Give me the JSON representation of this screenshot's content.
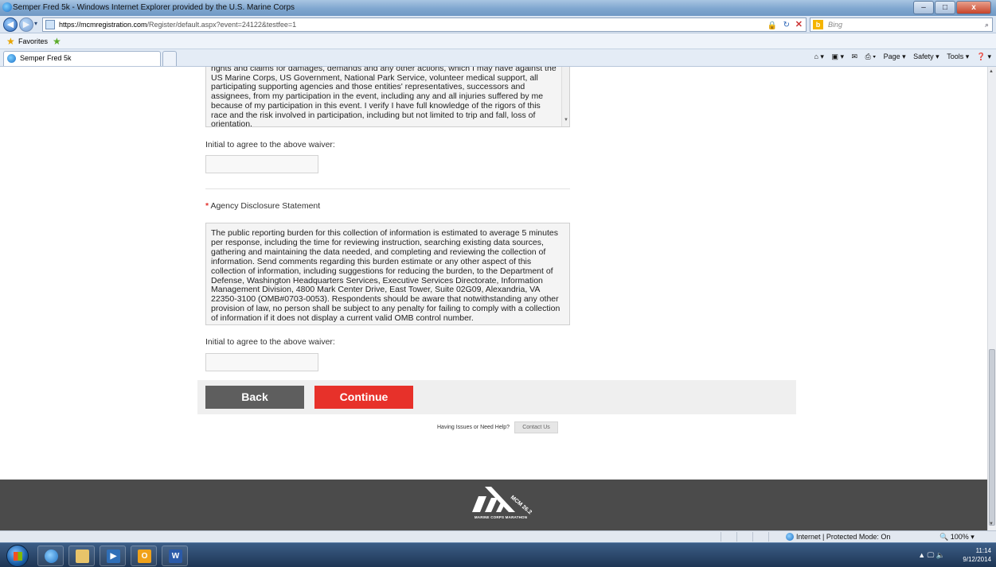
{
  "window": {
    "title": "Semper Fred 5k - Windows Internet Explorer provided by the U.S. Marine Corps",
    "minimize": "–",
    "maximize": "□",
    "close": "x"
  },
  "address_bar": {
    "url_host": "https://mcmregistration.com",
    "url_path": "/Register/default.aspx?event=24122&testfee=1",
    "search_placeholder": "Bing",
    "search_brand": "b"
  },
  "favorites_bar": {
    "label": "Favorites"
  },
  "tabs": {
    "active_tab": "Semper Fred 5k"
  },
  "command_bar": {
    "page": "Page ▾",
    "safety": "Safety ▾",
    "tools": "Tools ▾",
    "help": "❓ ▾"
  },
  "form": {
    "waiver_text": "rights and claims for damages, demands and any other actions, which I may have against the US Marine Corps, US Government, National Park Service, volunteer medical support, all participating supporting agencies and those entities' representatives, successors and assignees, from my participation in the event, including any and all injuries suffered by me because of my participation in this event.  I verify I have full knowledge of the rigors of this race and the risk involved in participation, including but not limited to trip and fall, loss of orientation,",
    "initial_label_1": "Initial to agree to the above waiver:",
    "disclosure_required_mark": "*",
    "disclosure_title": "Agency Disclosure Statement",
    "disclosure_text": "The public reporting burden for this collection of information is estimated to average 5 minutes per response, including the time for reviewing instruction, searching existing data sources, gathering and maintaining the data needed, and completing and reviewing the collection of information. Send comments regarding this burden estimate or any other aspect of this collection of information, including suggestions for reducing the burden, to the Department of Defense, Washington Headquarters Services, Executive Services Directorate, Information Management Division, 4800 Mark Center Drive, East Tower, Suite 02G09, Alexandria, VA 22350-3100 (OMB#0703-0053). Respondents should be aware that notwithstanding any other provision of law, no person shall be subject to any penalty for failing to comply with a collection of information if it does not display a current valid OMB control number.",
    "initial_label_2": "Initial to agree to the above waiver:",
    "initial_value_1": "",
    "initial_value_2": "",
    "back_label": "Back",
    "continue_label": "Continue"
  },
  "help": {
    "text": "Having Issues or Need Help?",
    "contact_label": "Contact Us"
  },
  "footer": {
    "logo_text": "MARINE CORPS MARATHON",
    "logo_badge": "MCM 26.2"
  },
  "status_bar": {
    "zone": "Internet | Protected Mode: On",
    "zoom": "100%"
  },
  "taskbar": {
    "time": "11:14",
    "date": "9/12/2014",
    "word_letter": "W",
    "outlook_letter": "O"
  },
  "colors": {
    "accent_red": "#e7312a",
    "back_gray": "#5e5e5e",
    "footer_bg": "#4b4b4b"
  }
}
